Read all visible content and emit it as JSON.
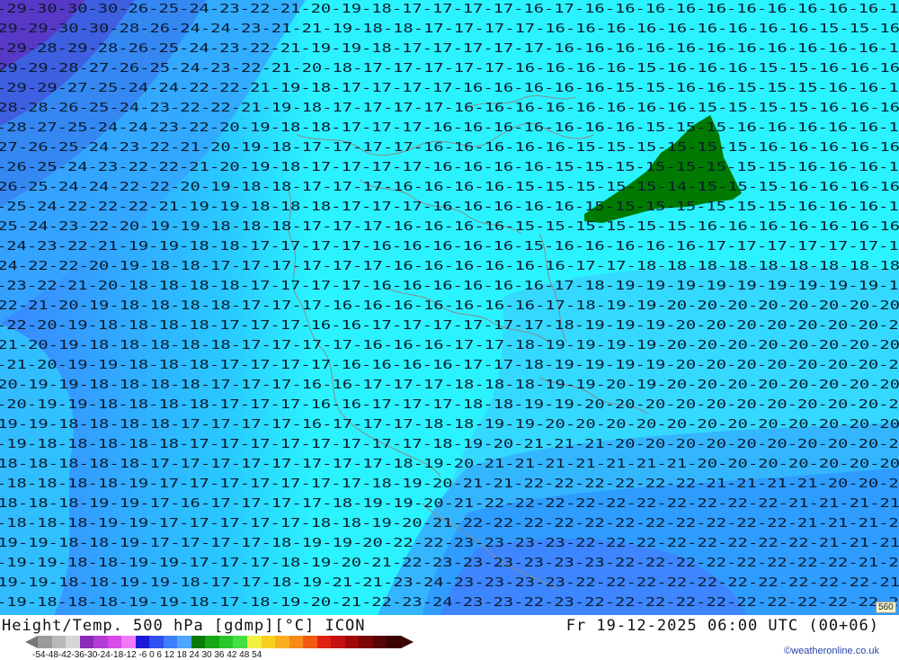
{
  "map": {
    "variable": "Height/Temp. 500 hPa [gdmp][°C] ICON",
    "valid_time": "Fr 19-12-2025 06:00 UTC (00+06)",
    "credit": "©weatheronline.co.uk",
    "contour_badge": "560",
    "colors": {
      "ocean_light": "#2af3ff",
      "band_18": "#27c9ff",
      "band_21": "#33a4ff",
      "band_24": "#3f88ff",
      "band_27": "#2a67ee",
      "band_30": "#3c44d8",
      "band_cold": "#5b37c9",
      "warm_patch": "#007a00",
      "labels": "#0b1a2e",
      "coast": "#888888"
    },
    "scale": {
      "labels": "-54-48-42-36-30-24-18-12 -6  0  6  12  18  24  30  36  42  48  54",
      "colors": [
        "#9b9b9b",
        "#b9b9b9",
        "#d6d6d6",
        "#8b2bb8",
        "#b43bd4",
        "#d94be8",
        "#f07af5",
        "#1a1ad8",
        "#2f4ff0",
        "#3f7dff",
        "#4fa6ff",
        "#0a7a0a",
        "#16a816",
        "#28c828",
        "#44e044",
        "#f0f040",
        "#f7d020",
        "#f8b020",
        "#f78a18",
        "#f25a12",
        "#e02010",
        "#c41010",
        "#a00808",
        "#7a0606",
        "#560404",
        "#3a0202"
      ]
    },
    "temperature_rows": [
      "-29-30-30-30-26-25-24-23-22-21-20-19-18-17-17-17-17-16-17-16-16-16-16-16-16-16-16-16-16-15",
      "-29-29-30-30-28-26-24-24-23-21-21-19-18-18-17-17-17-17-16-16-16-16-16-16-16-16-16-15-15-16",
      "-29-28-29-28-26-25-24-23-22-21-19-19-18-17-17-17-17-17-16-16-16-16-16-16-16-16-16-16-16-15",
      "-29-29-28-27-26-25-24-23-22-21-20-18-17-17-17-17-17-16-16-16-16-15-16-16-16-15-15-16-16-16",
      "-29-29-27-25-24-24-22-22-21-19-18-17-17-17-17-16-16-16-16-16-15-15-16-16-15-15-15-16-16-16",
      "-28-28-26-25-24-23-22-22-21-19-18-17-17-17-17-16-16-16-16-16-16-16-16-15-15-15-15-16-16-16",
      "-28-27-25-24-24-23-22-20-19-18-18-17-17-17-16-16-16-16-16-16-16-15-15-15-16-16-16-16-16-16",
      "-27-26-25-24-23-22-21-20-19-18-17-17-17-17-16-16-16-16-16-15-15-15-15-15-15-16-16-16-16-16",
      "-26-25-24-23-22-22-21-20-19-18-17-17-17-17-16-16-16-16-15-15-15-15-15-15-15-15-16-16-16-16",
      "-26-25-24-24-22-22-20-19-18-18-17-17-17-16-16-16-16-15-15-15-15-15-14-15-15-15-16-16-16-16",
      "-25-24-22-22-22-21-19-19-18-18-18-17-17-17-16-16-16-16-16-15-15-15-15-15-15-15-16-16-16-16",
      "-25-24-23-22-20-19-19-18-18-18-17-17-17-16-16-16-16-15-15-15-15-15-15-16-16-16-16-16-16-16",
      "-24-23-22-21-19-19-18-18-17-17-17-17-16-16-16-16-16-15-16-16-16-16-16-17-17-17-17-17-17-17",
      "-24-22-22-20-19-18-18-17-17-17-17-17-17-16-16-16-16-16-16-17-17-18-18-18-18-18-18-18-18-18",
      "-23-22-21-20-18-18-18-18-17-17-17-17-16-16-16-16-16-16-17-18-19-19-19-19-19-19-19-19-19-19",
      "-22-21-20-19-18-18-18-18-17-17-17-16-16-16-16-16-16-16-17-18-19-19-20-20-20-20-20-20-20-20",
      "-22-20-19-18-18-18-18-17-17-17-16-16-17-17-17-17-17-17-18-19-19-19-20-20-20-20-20-20-20-20",
      "-21-20-19-18-18-18-18-18-17-17-17-17-16-16-16-17-17-18-19-19-19-19-20-20-20-20-20-20-20-20",
      "-21-20-19-19-18-18-18-17-17-17-17-16-16-16-16-17-17-18-19-19-19-19-20-20-20-20-20-20-20-20",
      "-20-19-19-18-18-18-18-17-17-17-16-16-17-17-17-18-18-18-19-19-20-19-20-20-20-20-20-20-20-20",
      "-20-19-19-18-18-18-18-17-17-17-16-16-17-17-17-18-18-19-19-20-20-20-20-20-20-20-20-20-20-20",
      "-19-19-18-18-18-18-17-17-17-17-16-17-17-17-18-18-19-19-20-20-20-20-20-20-20-20-20-20-20-20",
      "-19-18-18-18-18-18-17-17-17-17-17-17-17-17-18-19-20-21-21-21-20-20-20-20-20-20-20-20-20-20",
      "-18-18-18-18-18-17-17-17-17-17-17-17-17-18-19-20-21-21-21-21-21-21-21-20-20-20-20-20-20-20",
      "-18-18-18-18-19-17-17-17-17-17-17-17-18-19-20-21-21-22-22-22-22-22-22-21-21-21-21-20-20-20",
      "-18-18-18-19-19-17-16-17-17-17-17-18-19-19-20-21-22-22-22-22-22-22-22-22-22-22-21-21-21-21",
      "-18-18-18-19-19-17-17-17-17-17-18-18-19-20-21-22-22-22-22-22-22-22-22-22-22-22-21-21-21-21",
      "-19-19-18-18-19-17-17-17-17-18-19-19-20-22-22-23-23-23-23-22-22-22-22-22-22-22-22-21-21-21",
      "-19-19-18-18-19-19-17-17-17-18-19-20-21-22-23-23-23-23-23-23-22-22-22-22-22-22-22-22-21-21",
      "-19-19-18-18-19-19-18-17-17-18-19-21-21-23-24-23-23-23-23-22-22-22-22-22-22-22-22-22-22-21",
      "-19-18-18-18-19-19-18-17-18-19-20-21-22-23-24-23-23-22-23-22-22-22-22-22-22-22-22-22-22-21"
    ]
  }
}
